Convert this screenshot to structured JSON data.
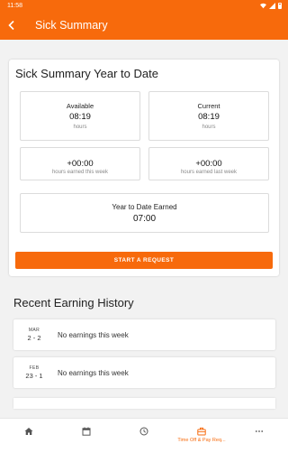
{
  "status_bar": {
    "time": "11:58"
  },
  "header": {
    "title": "Sick Summary"
  },
  "summary": {
    "title": "Sick Summary Year to Date",
    "available": {
      "label": "Available",
      "value": "08:19",
      "unit": "hours"
    },
    "current": {
      "label": "Current",
      "value": "08:19",
      "unit": "hours"
    },
    "this_week": {
      "value": "+00:00",
      "label": "hours earned this week"
    },
    "last_week": {
      "value": "+00:00",
      "label": "hours earned last week"
    },
    "ytd": {
      "label": "Year to Date Earned",
      "value": "07:00"
    },
    "button_label": "START A REQUEST"
  },
  "history": {
    "title": "Recent Earning History",
    "items": [
      {
        "month": "MAR",
        "range": "2 - 2",
        "text": "No earnings this week"
      },
      {
        "month": "FEB",
        "range": "23 - 1",
        "text": "No earnings this week"
      }
    ]
  },
  "nav": {
    "items": [
      {
        "icon": "home-icon",
        "label": ""
      },
      {
        "icon": "calendar-icon",
        "label": ""
      },
      {
        "icon": "clock-icon",
        "label": ""
      },
      {
        "icon": "briefcase-icon",
        "label": "Time Off & Pay Req..."
      },
      {
        "icon": "more-icon",
        "label": ""
      }
    ],
    "active_color": "#f76a0c",
    "inactive_color": "#555555"
  },
  "colors": {
    "accent": "#f76a0c",
    "background": "#f2f2f2",
    "card": "#ffffff"
  }
}
